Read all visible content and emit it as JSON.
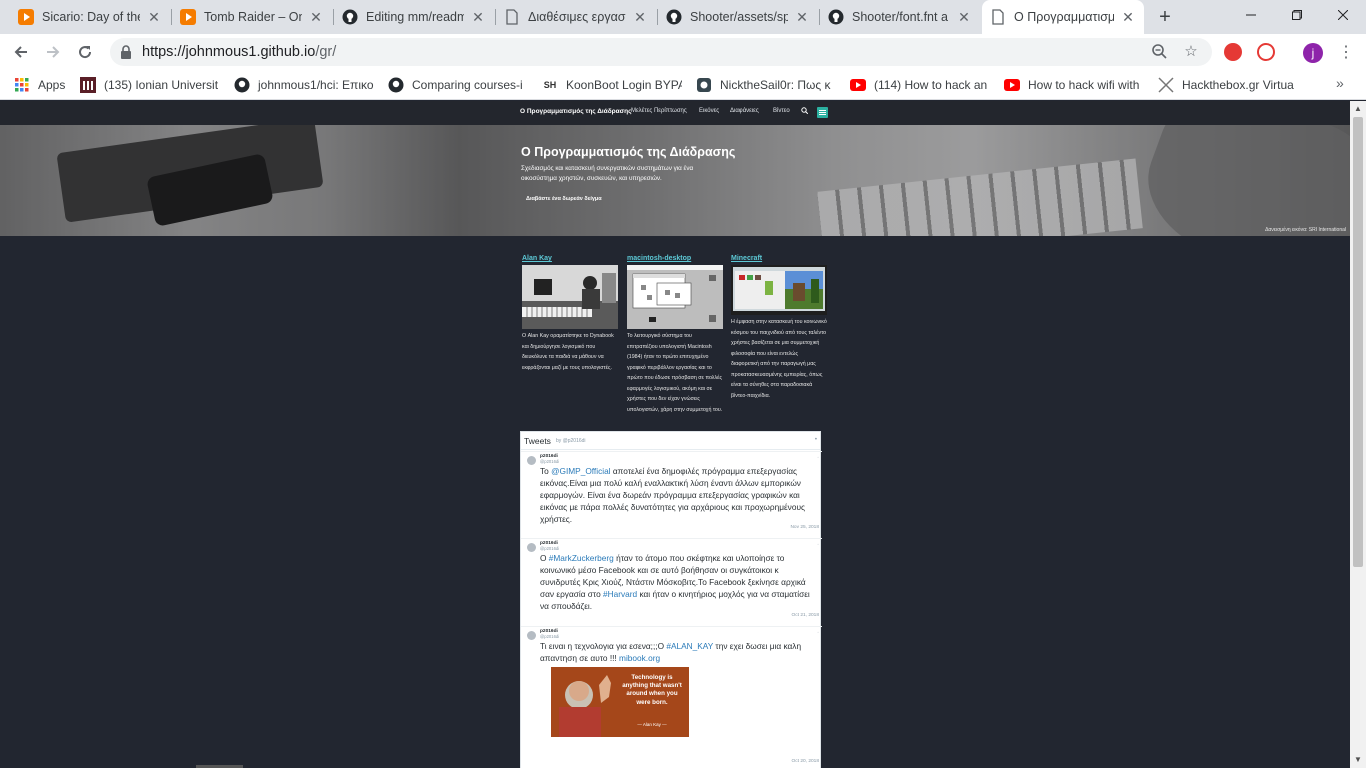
{
  "tabs": [
    {
      "title": "Sicario: Day of the",
      "icon": "play-icon"
    },
    {
      "title": "Tomb Raider – Onl",
      "icon": "play-icon"
    },
    {
      "title": "Editing mm/readm",
      "icon": "github-icon"
    },
    {
      "title": "Διαθέσιμες εργασί",
      "icon": "page-icon"
    },
    {
      "title": "Shooter/assets/sp",
      "icon": "github-icon"
    },
    {
      "title": "Shooter/font.fnt a",
      "icon": "github-icon"
    },
    {
      "title": "Ο Προγραμματισμ",
      "icon": "page-icon",
      "active": true
    }
  ],
  "address_bar": {
    "url_host": "https://johnmous1.github.io",
    "url_path": "/gr/"
  },
  "avatar_letter": "j",
  "bookmarks": [
    {
      "label": "Apps",
      "icon": "apps-grid-icon"
    },
    {
      "label": "(135) Ionian Universit",
      "icon": "ionian-icon"
    },
    {
      "label": "johnmous1/hci: Επικο",
      "icon": "github-icon"
    },
    {
      "label": "Comparing courses-i",
      "icon": "github-icon"
    },
    {
      "label": "KoonBoot Login BYPA",
      "icon": "koon-icon"
    },
    {
      "label": "NicktheSail0r: Πως κ",
      "icon": "blog-icon"
    },
    {
      "label": "(114) How to hack an",
      "icon": "youtube-icon"
    },
    {
      "label": "How to hack wifi with",
      "icon": "youtube-icon"
    },
    {
      "label": "Hackthebox.gr Virtua",
      "icon": "htb-icon"
    }
  ],
  "site_nav": {
    "brand": "Ο Προγραμματισμός της Διάδρασης",
    "items": [
      "Μελέτες Περίπτωσης",
      "Εικόνες",
      "Διαφάνειες",
      "Βίντεο"
    ]
  },
  "hero": {
    "title": "Ο Προγραμματισμός της Διάδρασης",
    "subtitle": "Σχεδιασμός και κατασκευή συνεργατικών συστημάτων για ένα οικοσύστημα χρηστών, συσκευών, και υπηρεσιών.",
    "cta": "Διαβάστε ένα δωρεάν δείγμα",
    "credit": "Δανεισμένη εικόνα: SRI International"
  },
  "cards": [
    {
      "title": "Alan Kay",
      "text": "Ο Alan Kay οραματίστηκε το Dynabook και δημιούργησε λογισμικό που διευκόλυνε τα παιδιά να μάθουν να εκφράζονται μαζί με τους υπολογιστές."
    },
    {
      "title": "macintosh-desktop",
      "text": "Το λειτουργικό σύστημα του επιτραπέζιου υπολογιστή Macintosh (1984) ήταν το πρώτο επιτυχημένο γραφικό περιβάλλον εργασίας και το πρώτο που έδωσε πρόσβαση σε πολλές εφαρμογές λογισμικού, ακόμη και σε χρήστες που δεν είχαν γνώσεις υπολογιστών, χάρη στην συμμετοχή του."
    },
    {
      "title": "Minecraft",
      "text": "Η έμφαση στην κατασκευή του κοινωνικό κόσμου του παιχνιδιού από τους ταλέντο χρήστες βασίζεται σε μια συμμετοχική φιλοσοφία που είναι εντελώς διαφορετική από την παραγωγή μας προκατασκευασμένης εμπειρίας, όπως είναι τα σύνηθες στα παραδοσιακά βίντεο-παιχνίδια."
    }
  ],
  "tweets_widget": {
    "title": "Tweets",
    "by": "by @p2016di",
    "tweets": [
      {
        "name": "p2016di",
        "handle": "@p2016di",
        "segments": [
          {
            "t": "Το "
          },
          {
            "t": "@GIMP_Official",
            "link": true
          },
          {
            "t": " αποτελεί ένα δημοφιλές πρόγραμμα επεξεργασίας εικόνας.Είναι μια πολύ καλή εναλλακτική λύση έναντι άλλων εμπορικών εφαρμογών. Είναι ένα δωρεάν πρόγραμμα επεξεργασίας γραφικών και εικόνας με πάρα πολλές δυνατότητες για αρχάριους και προχωρημένους χρήστες."
          }
        ],
        "date": "Nov 25, 2018"
      },
      {
        "name": "p2016di",
        "handle": "@p2016di",
        "segments": [
          {
            "t": "Ο "
          },
          {
            "t": "#MarkZuckerberg",
            "link": true
          },
          {
            "t": " ήταν το άτομο που σκέφτηκε και υλοποίησε το κοινωνικό μέσο Facebook και σε αυτό βοήθησαν οι συγκάτοικοι κ συνιδρυτές  Κρις Χιούζ, Ντάστιν Μόσκοβιτς.Το Facebook ξεκίνησε αρχικά σαν εργασία στο "
          },
          {
            "t": "#Harvard",
            "link": true
          },
          {
            "t": " και ήταν ο κινητήριος μοχλός για να σταματίσει να σπουδάζει."
          }
        ],
        "date": "Oct 21, 2018"
      },
      {
        "name": "p2016di",
        "handle": "@p2016di",
        "segments": [
          {
            "t": "Τι ειναι η τεχνολογια για εσενα;;;Ο "
          },
          {
            "t": "#ALAN_KAY",
            "link": true
          },
          {
            "t": " την εχει δωσει μια καλη απαντηση σε αυτο !!! "
          },
          {
            "t": "mibook.org",
            "link": true
          }
        ],
        "image_quote": "Technology is anything that wasn't around when you were born.",
        "image_author": "— Alan Kay —",
        "date": "Oct 20, 2018"
      }
    ]
  },
  "colors": {
    "page_bg": "#222630",
    "link_teal": "#5dc9d6",
    "accent_burger": "#2bb0a0",
    "twitter_link": "#2b7bb9"
  }
}
